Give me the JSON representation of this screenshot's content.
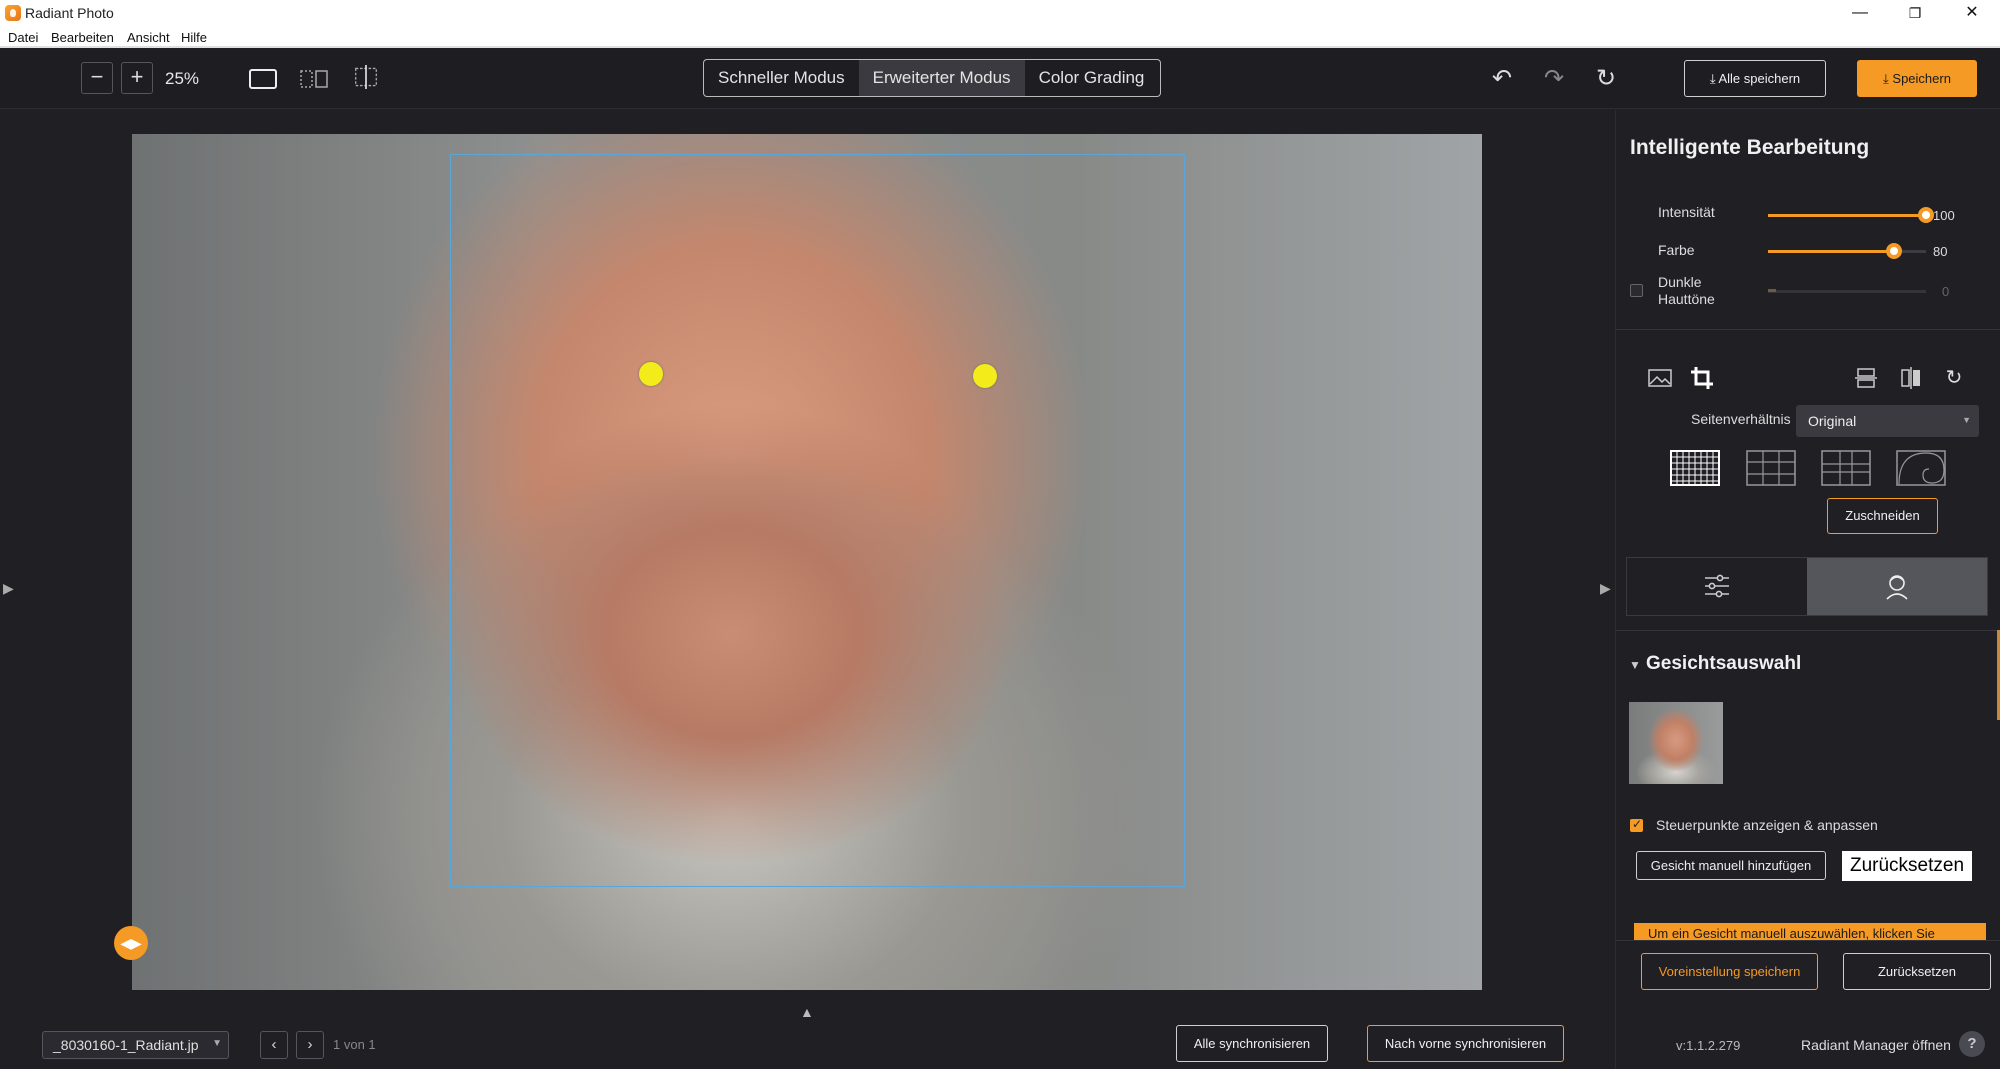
{
  "window": {
    "title": "Radiant Photo",
    "minimize": "—",
    "maximize": "❐",
    "close": "✕"
  },
  "menu": [
    "Datei",
    "Bearbeiten",
    "Ansicht",
    "Hilfe"
  ],
  "toolbar": {
    "zoom_out": "−",
    "zoom_in": "+",
    "zoom_value": "25%",
    "modes": [
      "Schneller Modus",
      "Erweiterter Modus",
      "Color Grading"
    ],
    "active_mode": 1,
    "undo": "↶",
    "redo": "↷",
    "reset": "↻",
    "save_all": "Alle speichern",
    "save": "Speichern"
  },
  "bottom": {
    "file_name": "_8030160-1_Radiant.jp",
    "prev": "‹",
    "next": "›",
    "page_info": "1 von 1",
    "sync_all": "Alle synchronisieren",
    "sync_forward": "Nach vorne synchronisieren"
  },
  "panel": {
    "title": "Intelligente Bearbeitung",
    "sliders": [
      {
        "label": "Intensität",
        "value": "100",
        "fraction": 1.0
      },
      {
        "label": "Farbe",
        "value": "80",
        "fraction": 0.8
      }
    ],
    "dark_skin": {
      "label_line1": "Dunkle",
      "label_line2": "Hauttöne",
      "value": "0",
      "checked": false
    },
    "aspect_label": "Seitenverhältnis",
    "aspect_value": "Original",
    "crop_button": "Zuschneiden",
    "section_title": "Gesichtsauswahl",
    "show_points_label": "Steuerpunkte anzeigen & anpassen",
    "show_points_checked": true,
    "add_face_manual": "Gesicht manuell hinzufügen",
    "reset_face": "Zurücksetzen",
    "banner_text": "Um ein Gesicht manuell auszuwählen, klicken Sie",
    "save_preset": "Voreinstellung speichern",
    "reset": "Zurücksetzen",
    "version": "v:1.1.2.279",
    "manager_link": "Radiant Manager öffnen",
    "help": "?"
  },
  "colors": {
    "accent": "#f59a24",
    "face_box": "#5aa6d8",
    "eye_marker": "#f4ec1a"
  }
}
